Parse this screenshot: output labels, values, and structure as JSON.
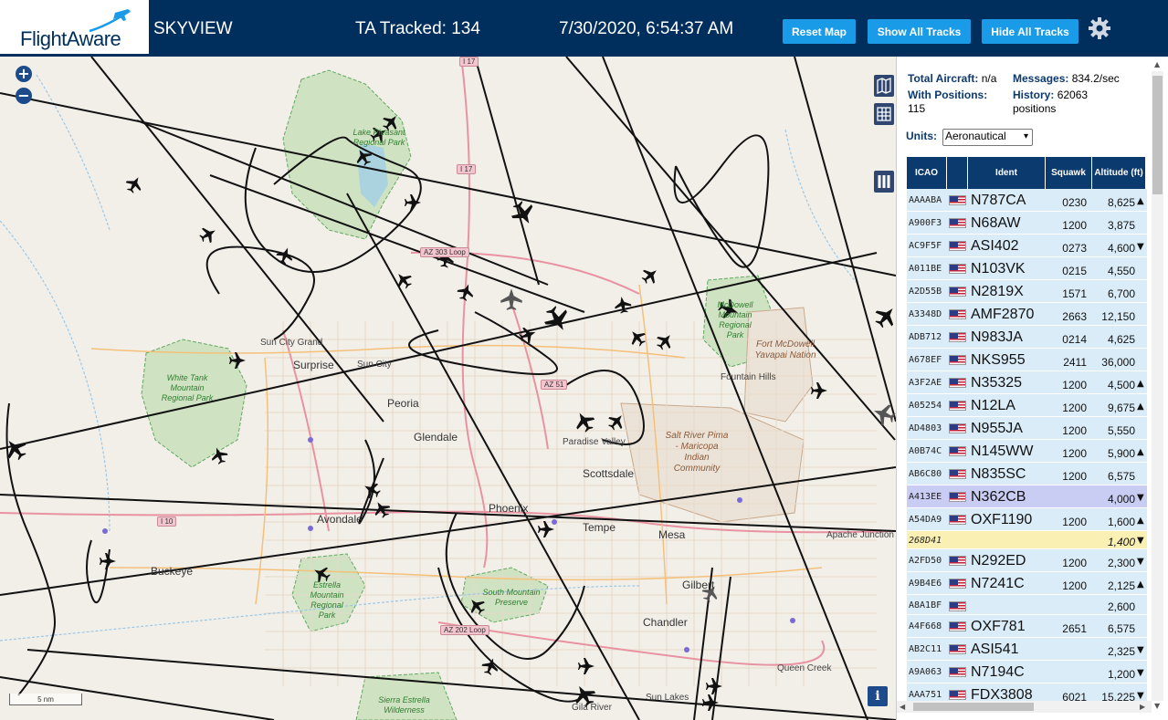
{
  "header": {
    "logo_text": "FlightAware",
    "app_title": "SKYVIEW",
    "tracked_label": "TA Tracked: 134",
    "datetime": "7/30/2020, 6:54:37 AM",
    "buttons": {
      "reset": "Reset Map",
      "show": "Show All Tracks",
      "hide": "Hide All Tracks"
    },
    "settings_icon": "gear-icon",
    "colors": {
      "bar": "#002f5d",
      "button": "#1a9be8"
    }
  },
  "map": {
    "zoom_in": "+",
    "zoom_out": "−",
    "scale_label": "5 nm",
    "info": "i",
    "cities": [
      "Surprise",
      "Peoria",
      "Glendale",
      "Phoenix",
      "Scottsdale",
      "Tempe",
      "Mesa",
      "Avondale",
      "Buckeye",
      "Chandler",
      "Gilbert"
    ],
    "towns": [
      "Sun City Grand",
      "Sun City",
      "Paradise Valley",
      "Fountain Hills",
      "Apache Junction",
      "Queen Creek",
      "Sun Lakes",
      "Gila River"
    ],
    "parks": [
      "Lake Pleasant Regional Park",
      "White Tank Mountain Regional Park",
      "McDowell Mountain Regional Park",
      "Estrella Mountain Regional Park",
      "Sierra Estrella Wilderness",
      "South Mountain Preserve"
    ],
    "reserves": [
      "Fort McDowell Yavapai Nation",
      "Salt River Pima - Maricopa Indian Community"
    ],
    "shields": [
      "I 17",
      "I 17",
      "AZ 303 Loop",
      "AZ 51",
      "I 10",
      "AZ 202 Loop"
    ]
  },
  "stats": {
    "total_aircraft_label": "Total Aircraft:",
    "total_aircraft_value": "n/a",
    "messages_label": "Messages:",
    "messages_value": "834.2/sec",
    "with_positions_label": "With Positions:",
    "with_positions_value": "115",
    "history_label": "History:",
    "history_value": "62063 positions"
  },
  "units": {
    "label": "Units:",
    "selected": "Aeronautical"
  },
  "table": {
    "headers": {
      "icao": "ICAO",
      "ident": "Ident",
      "squawk": "Squawk",
      "altitude": "Altitude (ft)"
    },
    "rows": [
      {
        "icao": "AAAABA",
        "ident": "N787CA",
        "squawk": "0230",
        "alt": "8,625",
        "trend": "▲"
      },
      {
        "icao": "A900F3",
        "ident": "N68AW",
        "squawk": "1200",
        "alt": "3,875",
        "trend": ""
      },
      {
        "icao": "AC9F5F",
        "ident": "ASI402",
        "squawk": "0273",
        "alt": "4,600",
        "trend": "▼"
      },
      {
        "icao": "A011BE",
        "ident": "N103VK",
        "squawk": "0215",
        "alt": "4,550",
        "trend": ""
      },
      {
        "icao": "A2D55B",
        "ident": "N2819X",
        "squawk": "1571",
        "alt": "6,700",
        "trend": ""
      },
      {
        "icao": "A3348D",
        "ident": "AMF2870",
        "squawk": "2663",
        "alt": "12,150",
        "trend": ""
      },
      {
        "icao": "ADB712",
        "ident": "N983JA",
        "squawk": "0214",
        "alt": "4,625",
        "trend": ""
      },
      {
        "icao": "A678EF",
        "ident": "NKS955",
        "squawk": "2411",
        "alt": "36,000",
        "trend": ""
      },
      {
        "icao": "A3F2AE",
        "ident": "N35325",
        "squawk": "1200",
        "alt": "4,500",
        "trend": "▲"
      },
      {
        "icao": "A05254",
        "ident": "N12LA",
        "squawk": "1200",
        "alt": "9,675",
        "trend": "▲"
      },
      {
        "icao": "AD4803",
        "ident": "N955JA",
        "squawk": "1200",
        "alt": "5,550",
        "trend": ""
      },
      {
        "icao": "A0B74C",
        "ident": "N145WW",
        "squawk": "1200",
        "alt": "5,900",
        "trend": "▲"
      },
      {
        "icao": "AB6C80",
        "ident": "N835SC",
        "squawk": "1200",
        "alt": "6,575",
        "trend": ""
      },
      {
        "icao": "A413EE",
        "ident": "N362CB",
        "squawk": "",
        "alt": "4,000",
        "trend": "▼"
      },
      {
        "icao": "A54DA9",
        "ident": "OXF1190",
        "squawk": "1200",
        "alt": "1,600",
        "trend": "▲"
      },
      {
        "icao": "268D41",
        "ident": "",
        "squawk": "",
        "alt": "1,400",
        "trend": "▼"
      },
      {
        "icao": "A2FD50",
        "ident": "N292ED",
        "squawk": "1200",
        "alt": "2,300",
        "trend": "▼"
      },
      {
        "icao": "A9B4E6",
        "ident": "N7241C",
        "squawk": "1200",
        "alt": "2,125",
        "trend": "▲"
      },
      {
        "icao": "A8A1BF",
        "ident": "",
        "squawk": "",
        "alt": "2,600",
        "trend": ""
      },
      {
        "icao": "A4F668",
        "ident": "OXF781",
        "squawk": "2651",
        "alt": "6,575",
        "trend": ""
      },
      {
        "icao": "AB2C11",
        "ident": "ASI541",
        "squawk": "",
        "alt": "2,325",
        "trend": "▼"
      },
      {
        "icao": "A9A063",
        "ident": "N7194C",
        "squawk": "",
        "alt": "1,200",
        "trend": "▼"
      },
      {
        "icao": "AAA751",
        "ident": "FDX3808",
        "squawk": "6021",
        "alt": "15,225",
        "trend": "▼"
      }
    ],
    "colors": {
      "row": "#daecf8",
      "selected": "#c9cdf3",
      "no_position": "#fbf0b4",
      "header": "#0a3a6e"
    }
  }
}
